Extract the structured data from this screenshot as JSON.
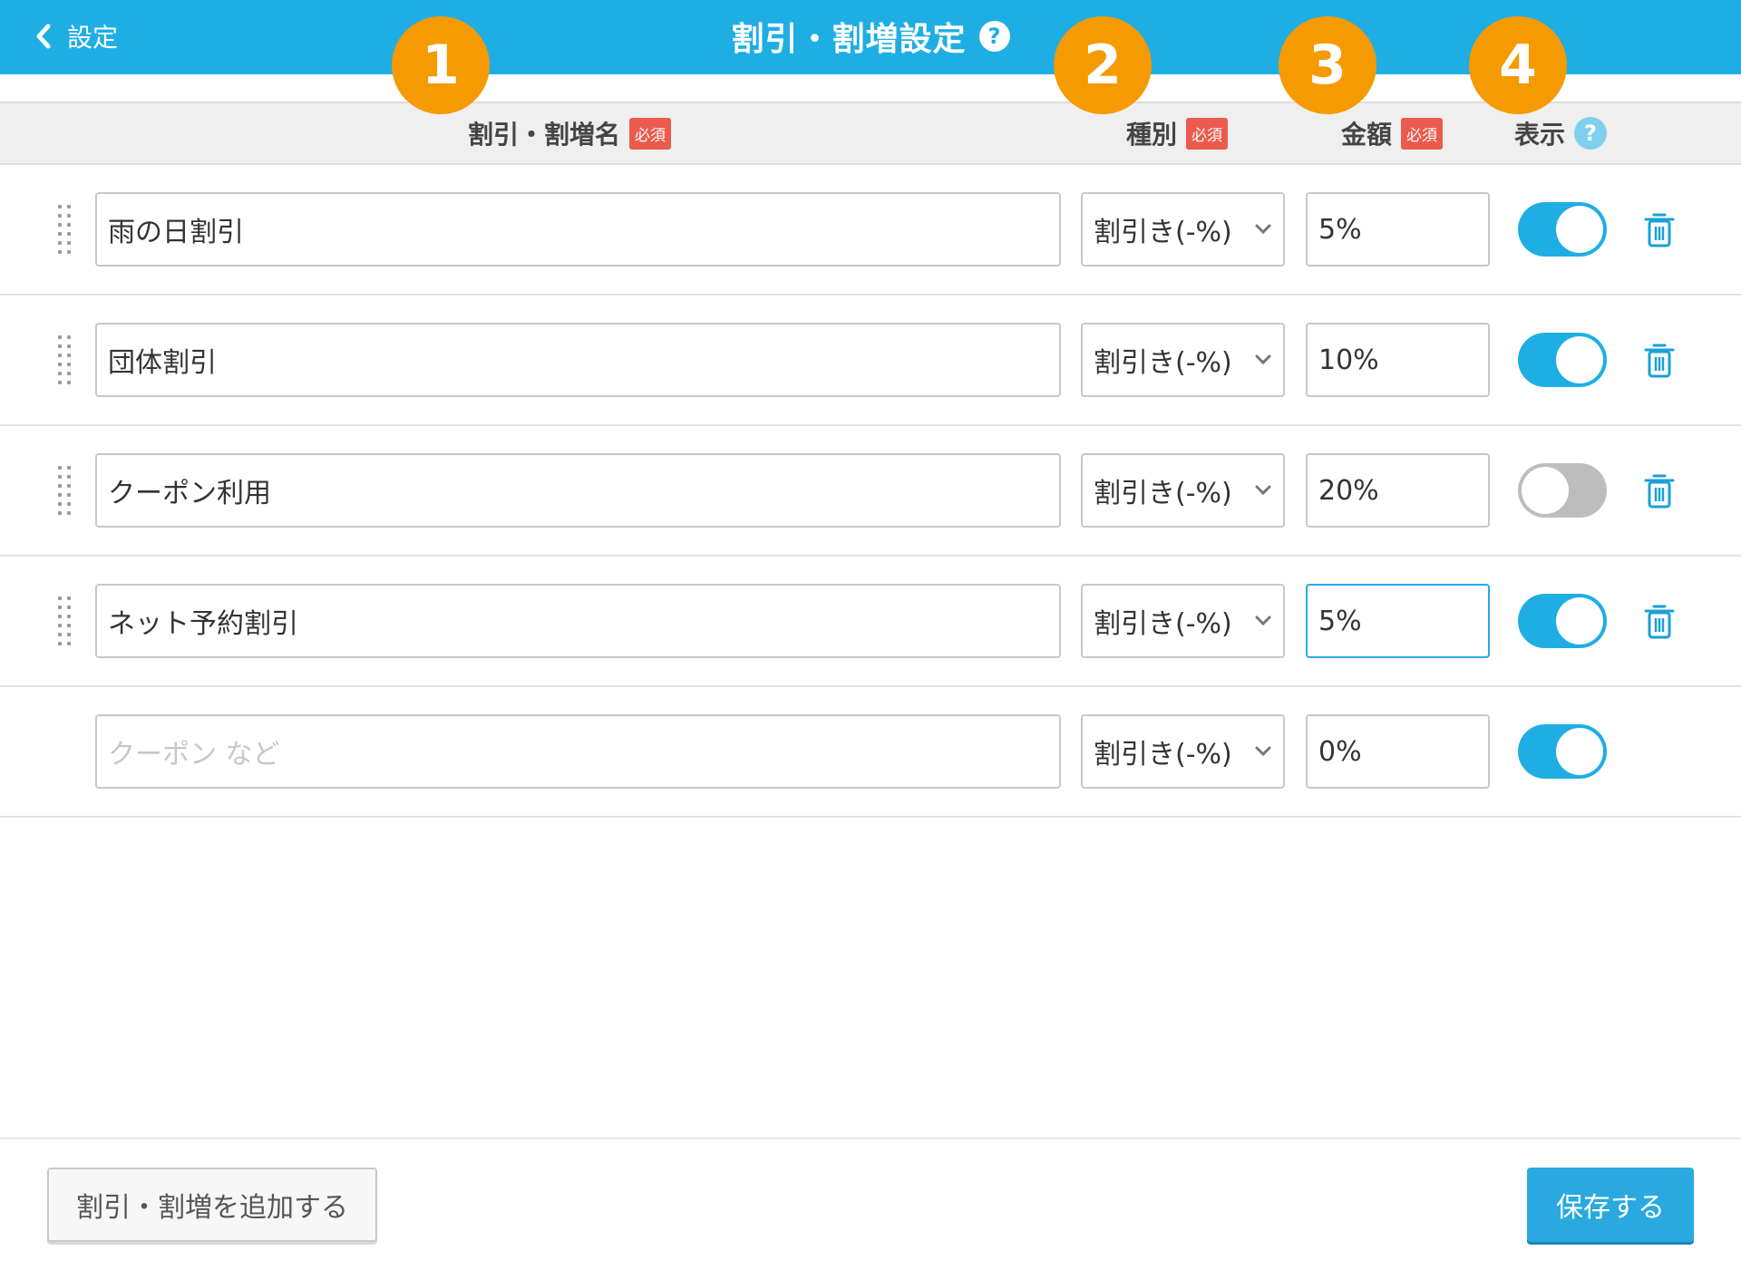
{
  "header": {
    "back_label": "設定",
    "title": "割引・割増設定",
    "help_glyph": "?"
  },
  "markers": [
    "1",
    "2",
    "3",
    "4"
  ],
  "columns": {
    "name": "割引・割増名",
    "type": "種別",
    "amount": "金額",
    "display": "表示",
    "required_badge": "必須",
    "help_glyph": "?"
  },
  "rows": [
    {
      "name": "雨の日割引",
      "type": "割引き(-%)",
      "amount": "5%",
      "display_on": true
    },
    {
      "name": "団体割引",
      "type": "割引き(-%)",
      "amount": "10%",
      "display_on": true
    },
    {
      "name": "クーポン利用",
      "type": "割引き(-%)",
      "amount": "20%",
      "display_on": false
    },
    {
      "name": "ネット予約割引",
      "type": "割引き(-%)",
      "amount": "5%",
      "display_on": true,
      "amount_focused": true
    }
  ],
  "new_row": {
    "name_placeholder": "クーポン など",
    "type": "割引き(-%)",
    "amount": "0%",
    "display_on": true
  },
  "footer": {
    "add_label": "割引・割増を追加する",
    "save_label": "保存する"
  },
  "colors": {
    "header_bg": "#1eaee4",
    "marker": "#f59a00",
    "required_badge": "#ec5a4d",
    "toggle_on": "#1eaee4",
    "toggle_off": "#bdbdbd",
    "save_button": "#2aa9e0"
  },
  "icons": {
    "back": "chevron-left-icon",
    "help": "question-circle-icon",
    "drag": "drag-handle-icon",
    "dropdown": "chevron-down-icon",
    "delete": "trash-icon"
  }
}
